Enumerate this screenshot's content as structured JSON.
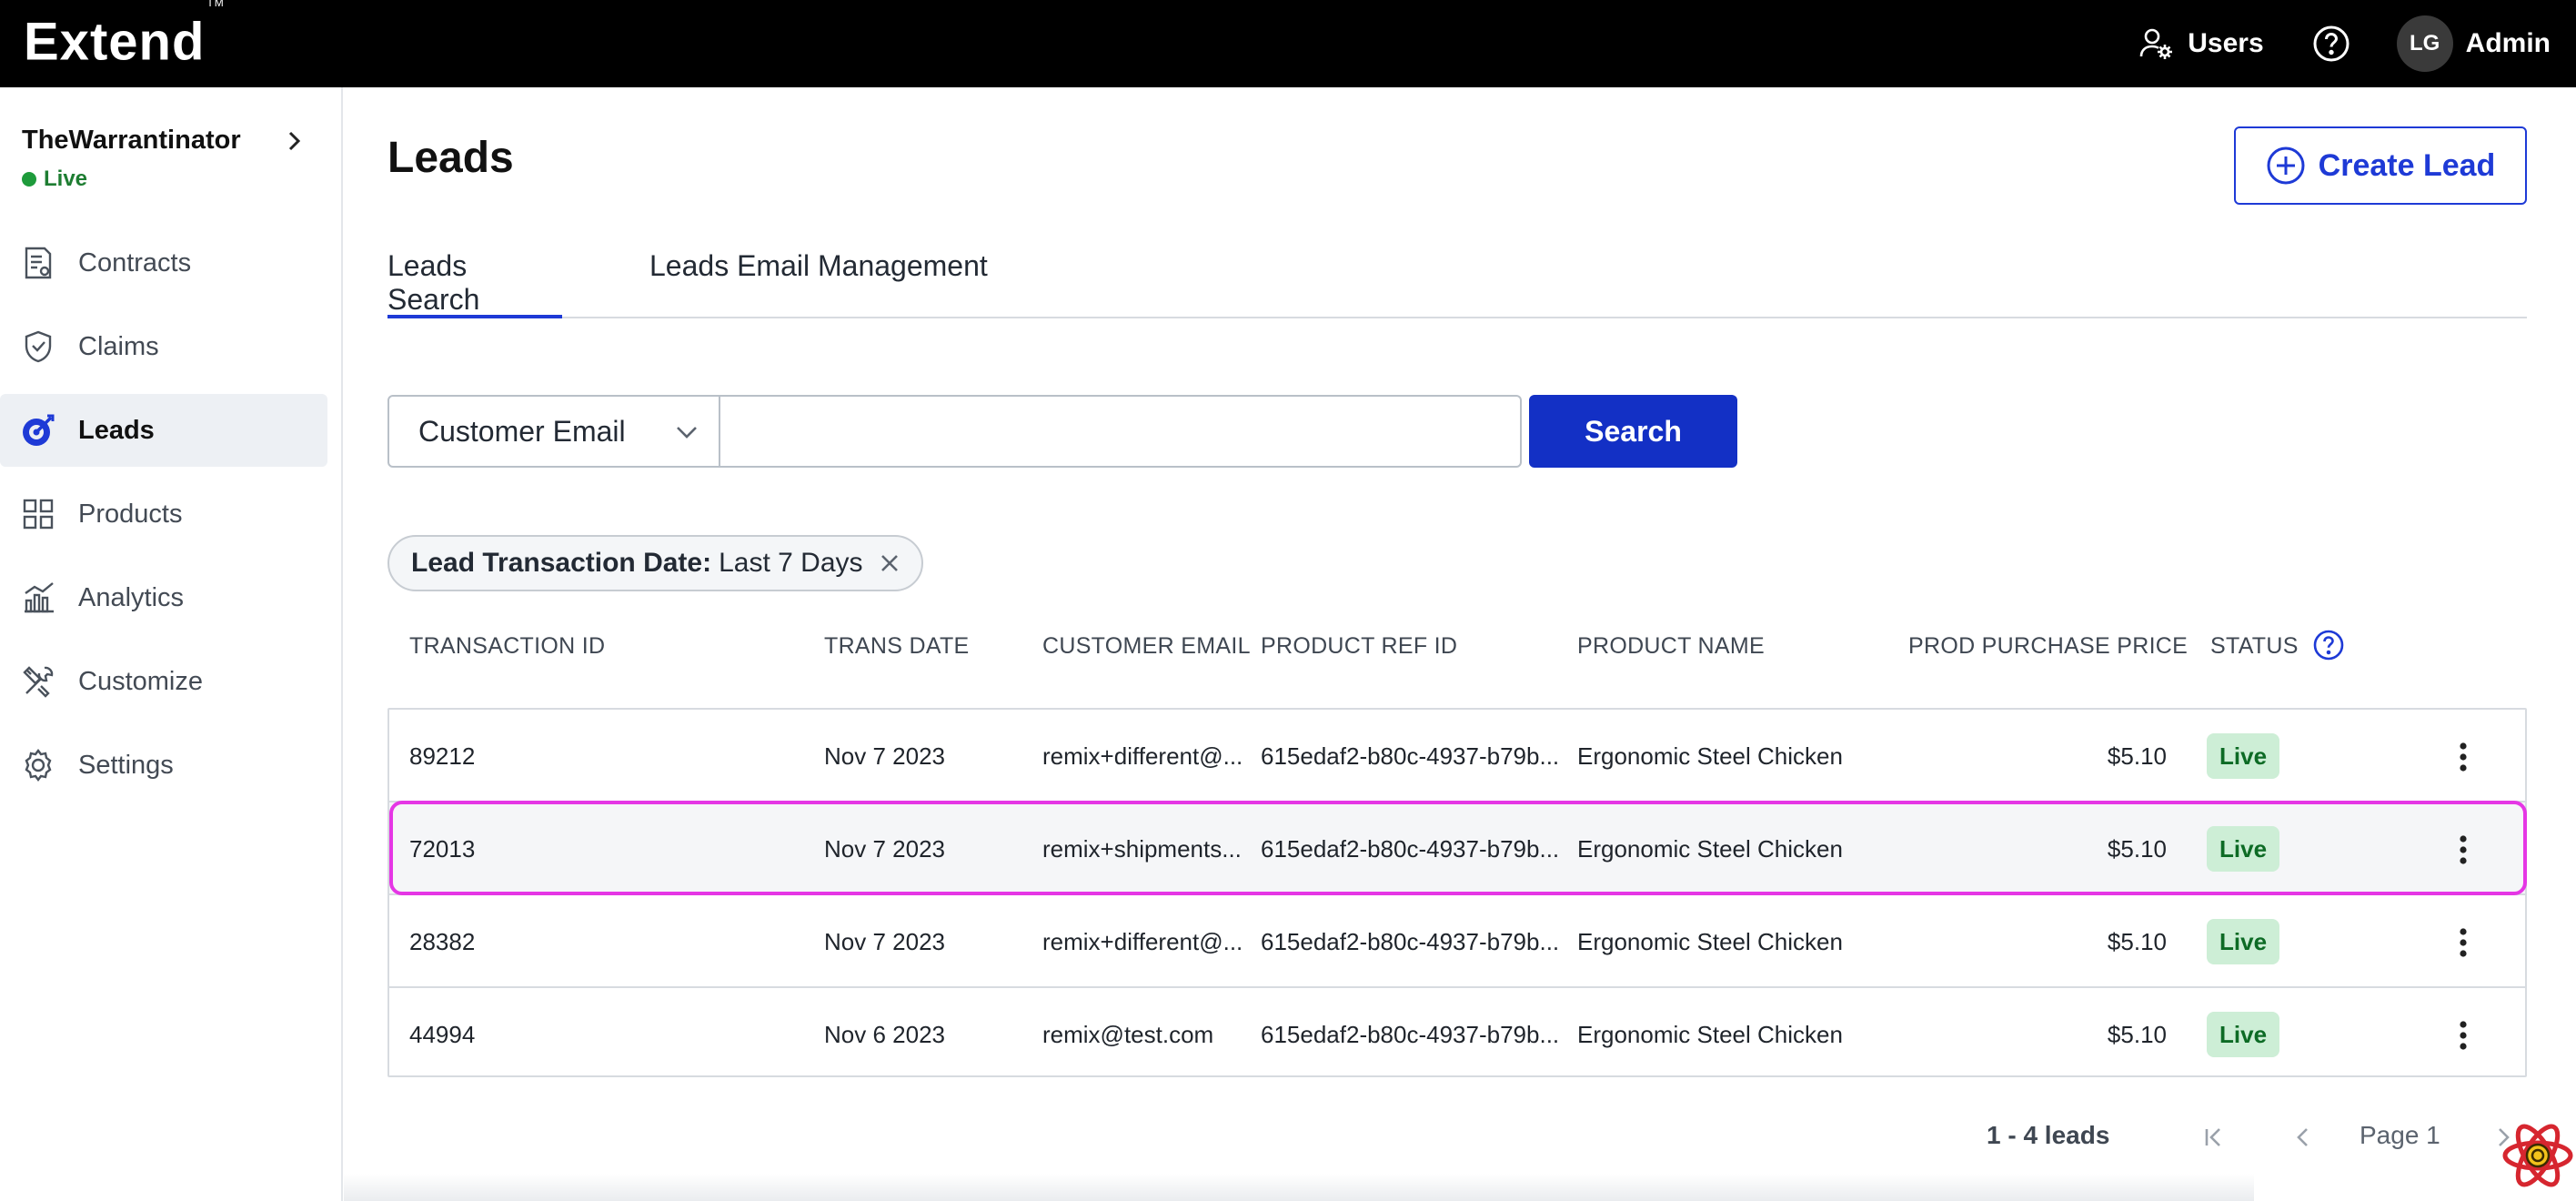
{
  "topbar": {
    "logo": "Extend",
    "logo_tm": "TM",
    "users_label": "Users",
    "avatar_initials": "LG",
    "admin_label": "Admin"
  },
  "sidebar": {
    "store_name": "TheWarrantinator",
    "store_status": "Live",
    "items": [
      {
        "label": "Contracts",
        "icon": "contracts-icon"
      },
      {
        "label": "Claims",
        "icon": "shield-icon"
      },
      {
        "label": "Leads",
        "icon": "leads-icon",
        "active": true
      },
      {
        "label": "Products",
        "icon": "grid-icon"
      },
      {
        "label": "Analytics",
        "icon": "bar-chart-icon"
      },
      {
        "label": "Customize",
        "icon": "tools-icon"
      },
      {
        "label": "Settings",
        "icon": "gear-icon"
      }
    ]
  },
  "main": {
    "title": "Leads",
    "create_label": "Create Lead",
    "tabs": [
      {
        "label": "Leads Search",
        "active": true
      },
      {
        "label": "Leads Email Management",
        "active": false
      }
    ],
    "search": {
      "field_selected": "Customer Email",
      "input_value": "",
      "button_label": "Search"
    },
    "filter_chip": {
      "key": "Lead Transaction Date:",
      "value": "Last 7 Days"
    },
    "columns": [
      "TRANSACTION ID",
      "TRANS DATE",
      "CUSTOMER EMAIL",
      "PRODUCT REF ID",
      "PRODUCT NAME",
      "PROD PURCHASE PRICE",
      "STATUS"
    ],
    "rows": [
      {
        "id": "89212",
        "date": "Nov 7 2023",
        "email": "remix+different@...",
        "ref": "615edaf2-b80c-4937-b79b...",
        "name": "Ergonomic Steel Chicken",
        "price": "$5.10",
        "status": "Live"
      },
      {
        "id": "72013",
        "date": "Nov 7 2023",
        "email": "remix+shipments...",
        "ref": "615edaf2-b80c-4937-b79b...",
        "name": "Ergonomic Steel Chicken",
        "price": "$5.10",
        "status": "Live"
      },
      {
        "id": "28382",
        "date": "Nov 7 2023",
        "email": "remix+different@...",
        "ref": "615edaf2-b80c-4937-b79b...",
        "name": "Ergonomic Steel Chicken",
        "price": "$5.10",
        "status": "Live"
      },
      {
        "id": "44994",
        "date": "Nov 6 2023",
        "email": "remix@test.com",
        "ref": "615edaf2-b80c-4937-b79b...",
        "name": "Ergonomic Steel Chicken",
        "price": "$5.10",
        "status": "Live"
      }
    ],
    "pagination": {
      "count": "1 - 4 leads",
      "page": "Page 1"
    }
  },
  "colors": {
    "brand_blue": "#1330c5",
    "live_green": "#1e9b3b",
    "badge_bg": "#cdeed6",
    "highlight_outline": "#e536e5"
  }
}
